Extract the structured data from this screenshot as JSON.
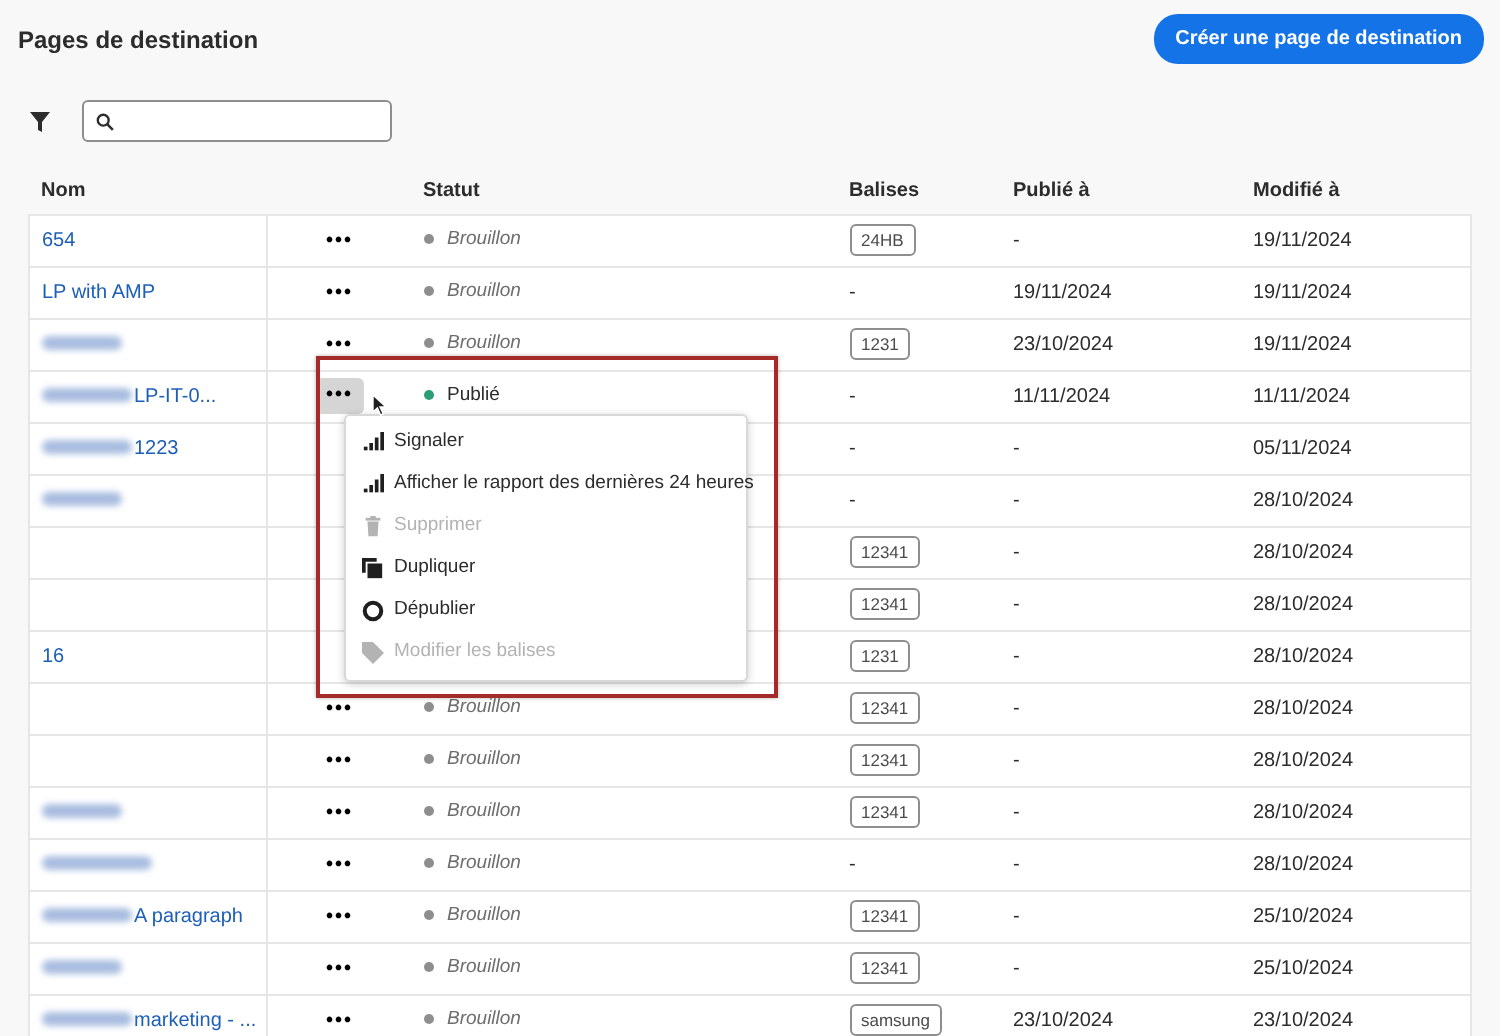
{
  "page": {
    "title": "Pages de destination",
    "create_button": "Créer une page de destination"
  },
  "table": {
    "columns": [
      "Nom",
      "Statut",
      "Balises",
      "Publié à",
      "Modifié à"
    ],
    "rows": [
      {
        "name": "654",
        "redacted": false,
        "actions": "•••",
        "actions_active": false,
        "status": {
          "text": "Brouillon",
          "kind": "draft",
          "color": "#8e8e8e"
        },
        "tag": "24HB",
        "published": "-",
        "modified": "19/11/2024"
      },
      {
        "name": "LP with AMP",
        "redacted": false,
        "actions": "•••",
        "actions_active": false,
        "status": {
          "text": "Brouillon",
          "kind": "draft",
          "color": "#8e8e8e"
        },
        "tag_text": "-",
        "published": "19/11/2024",
        "modified": "19/11/2024"
      },
      {
        "redacted": true,
        "actions": "•••",
        "actions_active": false,
        "status": {
          "text": "Brouillon",
          "kind": "draft",
          "color": "#8e8e8e"
        },
        "tag": "1231",
        "published": "23/10/2024",
        "modified": "19/11/2024"
      },
      {
        "name": "LP-IT-0...",
        "redacted": true,
        "actions": "•••",
        "actions_active": true,
        "status": {
          "text": "Publié",
          "kind": "published",
          "color": "#2d9d78"
        },
        "tag_text": "-",
        "published": "11/11/2024",
        "modified": "11/11/2024"
      },
      {
        "name": "1223",
        "redacted": true,
        "tag_text": "-",
        "published": "-",
        "modified": "05/11/2024"
      },
      {
        "redacted": true,
        "tag_text": "-",
        "published": "-",
        "modified": "28/10/2024"
      },
      {
        "redacted": false,
        "tag": "12341",
        "published": "-",
        "modified": "28/10/2024"
      },
      {
        "redacted": false,
        "tag": "12341",
        "published": "-",
        "modified": "28/10/2024"
      },
      {
        "name": "16",
        "redacted": false,
        "tag": "1231",
        "published": "-",
        "modified": "28/10/2024"
      },
      {
        "redacted": false,
        "actions": "•••",
        "actions_active": false,
        "status": {
          "text": "Brouillon",
          "kind": "draft",
          "color": "#8e8e8e"
        },
        "tag": "12341",
        "published": "-",
        "modified": "28/10/2024"
      },
      {
        "redacted": false,
        "actions": "•••",
        "actions_active": false,
        "status": {
          "text": "Brouillon",
          "kind": "draft",
          "color": "#8e8e8e"
        },
        "tag": "12341",
        "published": "-",
        "modified": "28/10/2024"
      },
      {
        "redacted": true,
        "actions": "•••",
        "actions_active": false,
        "status": {
          "text": "Brouillon",
          "kind": "draft",
          "color": "#8e8e8e"
        },
        "tag": "12341",
        "published": "-",
        "modified": "28/10/2024"
      },
      {
        "redacted": true,
        "actions": "•••",
        "actions_active": false,
        "status": {
          "text": "Brouillon",
          "kind": "draft",
          "color": "#8e8e8e"
        },
        "tag_text": "-",
        "published": "-",
        "modified": "28/10/2024"
      },
      {
        "name": "A paragraph",
        "redacted": true,
        "actions": "•••",
        "actions_active": false,
        "status": {
          "text": "Brouillon",
          "kind": "draft",
          "color": "#8e8e8e"
        },
        "tag": "12341",
        "published": "-",
        "modified": "25/10/2024"
      },
      {
        "redacted": true,
        "actions": "•••",
        "actions_active": false,
        "status": {
          "text": "Brouillon",
          "kind": "draft",
          "color": "#8e8e8e"
        },
        "tag": "12341",
        "published": "-",
        "modified": "25/10/2024"
      },
      {
        "name": "marketing - ...",
        "redacted": true,
        "actions": "•••",
        "actions_active": false,
        "status": {
          "text": "Brouillon",
          "kind": "draft",
          "color": "#8e8e8e"
        },
        "tag": "samsung",
        "published": "23/10/2024",
        "modified": "23/10/2024"
      }
    ]
  },
  "context_menu": {
    "items": [
      {
        "kind": "report",
        "label": "Signaler",
        "disabled": false
      },
      {
        "kind": "report",
        "label": "Afficher le rapport des dernières 24 heures",
        "disabled": false
      },
      {
        "kind": "delete",
        "label": "Supprimer",
        "disabled": true
      },
      {
        "kind": "duplicate",
        "label": "Dupliquer",
        "disabled": false
      },
      {
        "kind": "unpublish",
        "label": "Dépublier",
        "disabled": false
      },
      {
        "kind": "tags",
        "label": "Modifier les balises",
        "disabled": true
      }
    ]
  }
}
